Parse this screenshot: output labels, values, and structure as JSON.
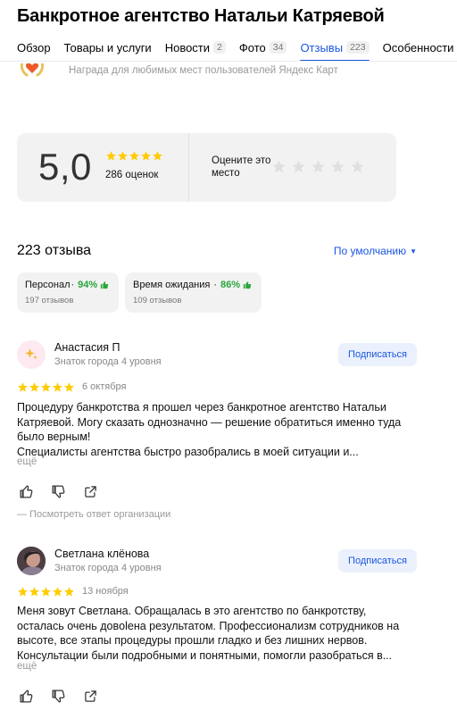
{
  "page": {
    "title": "Банкротное агентство Натальи Катряевой"
  },
  "tabs": [
    {
      "label": "Обзор",
      "count": ""
    },
    {
      "label": "Товары и услуги",
      "count": ""
    },
    {
      "label": "Новости",
      "count": "2"
    },
    {
      "label": "Фото",
      "count": "34"
    },
    {
      "label": "Отзывы",
      "count": "223",
      "active": true
    },
    {
      "label": "Особенности",
      "count": ""
    }
  ],
  "award": {
    "text": "Награда для любимых мест пользователей Яндекс Карт",
    "icon": "heart-laurel-icon"
  },
  "rating": {
    "value": "5,0",
    "stars": 5,
    "count": "286 оценок",
    "rate_prompt": "Оцените это место"
  },
  "reviews_header": {
    "count": "223 отзыва",
    "sort": "По умолчанию"
  },
  "aspects": [
    {
      "name": "Персонал",
      "percent": "94%",
      "reviews": "197 отзывов"
    },
    {
      "name": "Время ожидания",
      "percent": "86%",
      "reviews": "109 отзывов"
    }
  ],
  "reviews": [
    {
      "author": "Анастасия П",
      "level": "Знаток города 4 уровня",
      "subscribe": "Подписаться",
      "stars": 5,
      "date": "6 октября",
      "text": "Процедуру банкротства я прошел через банкротное агентство Натальи Катряевой. Могу сказать однозначно — решение обратиться именно туда было верным!\nСпециалисты агентства быстро разобрались в моей ситуации и...",
      "more": "ещё",
      "org_answer": "— Посмотреть ответ организации"
    },
    {
      "author": "Светлана клёнова",
      "level": "Знаток города 4 уровня",
      "subscribe": "Подписаться",
      "stars": 5,
      "date": "13 ноября",
      "text": "Меня зовут Светлана. Обращалась в это агентство по банкротству, осталась очень довolена результатом. Профессионализм сотрудников на высоте, все этапы процедуры прошли гладко и без лишних нервов. Консультации были подробными и понятными, помогли разобраться в...",
      "more": "ещё"
    }
  ],
  "colors": {
    "accent": "#1a56e0",
    "star": "#fc0",
    "positive": "#2aa53a",
    "card_bg": "#f2f2f2"
  }
}
